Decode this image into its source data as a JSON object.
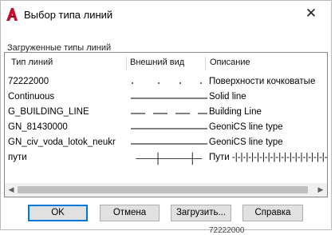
{
  "window": {
    "title": "Выбор типа линий",
    "close_glyph": "✕"
  },
  "group_label": "Загруженные типы линий",
  "columns": {
    "name": "Тип линий",
    "appearance": "Внешний вид",
    "description": "Описание"
  },
  "rows": [
    {
      "name": "72222000",
      "description": "Поверхности кочковатые",
      "pattern": "dots"
    },
    {
      "name": "Continuous",
      "description": "Solid line",
      "pattern": "solid"
    },
    {
      "name": "G_BUILDING_LINE",
      "description": "Building Line",
      "pattern": "dashed"
    },
    {
      "name": "GN_81430000",
      "description": "GeoniCS line type",
      "pattern": "solid"
    },
    {
      "name": "GN_civ_voda_lotok_neukr",
      "description": "GeoniCS line type",
      "pattern": "solid"
    },
    {
      "name": "пути",
      "description": "Пути -|-|-|-|-|-|-|-|-|-|-|-|-|-|-|-|-|-|-|",
      "pattern": "ticks"
    }
  ],
  "scrollbar": {
    "left_arrow": "◀",
    "right_arrow": "▶"
  },
  "buttons": {
    "ok": "OK",
    "cancel": "Отмена",
    "load": "Загрузить...",
    "help": "Справка"
  },
  "background_text": "72222000",
  "colors": {
    "app_icon": "#c8102e",
    "default_button_border": "#0078d7"
  }
}
